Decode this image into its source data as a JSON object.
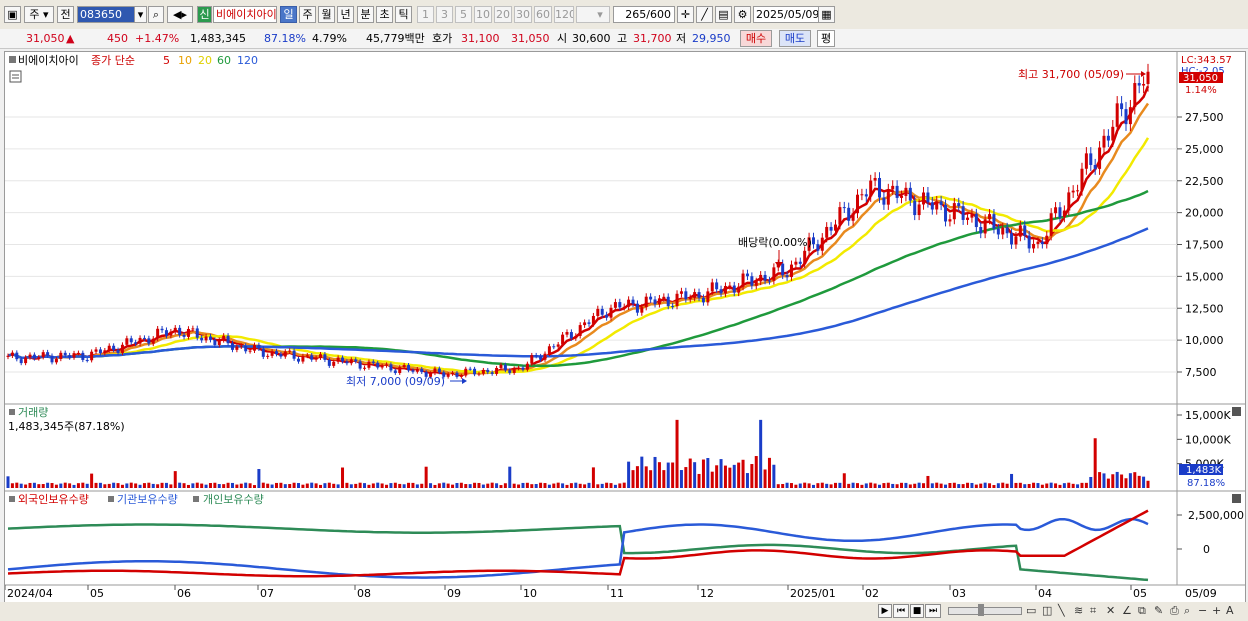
{
  "toolbar": {
    "market": "주",
    "all": "전",
    "code": "083650",
    "new_badge": "신",
    "name": "비에이치아이",
    "periods": [
      "일",
      "주",
      "월",
      "년",
      "분",
      "초",
      "틱"
    ],
    "active_period": "일",
    "minutes": [
      "1",
      "3",
      "5",
      "10",
      "20",
      "30",
      "60",
      "120"
    ],
    "count": "265",
    "count_max": "/600",
    "date": "2025/05/09"
  },
  "quote": {
    "price": "31,050",
    "arrow": "▲",
    "change": "450",
    "change_pct": "+1.47%",
    "volume": "1,483,345",
    "vol_ratio": "87.18%",
    "turnover": "4.79%",
    "amount": "45,779백만",
    "hoga_label": "호가",
    "ask": "31,100",
    "bid": "31,050",
    "open_label": "시",
    "open": "30,600",
    "high_label": "고",
    "high": "31,700",
    "low_label": "저",
    "low": "29,950",
    "buy_label": "매수",
    "sell_label": "매도",
    "eval_label": "평"
  },
  "price_panel": {
    "stock": "비에이치아이",
    "ma_label": "종가 단순",
    "ma_periods": [
      "5",
      "10",
      "20",
      "60",
      "120"
    ],
    "ma_colors": [
      "#d20000",
      "#e88a1e",
      "#f2ea00",
      "#1f9a3c",
      "#2a5ad8"
    ],
    "lc": "LC:343.57",
    "hc": "HC:-2.05",
    "price_tag": "31,050",
    "pct_tag": "1.14%",
    "high_note": "최고 31,700 (05/09)",
    "low_note": "최저 7,000 (09/09)",
    "dividend_note": "배당락(0.00%)",
    "y_ticks": [
      "27,500",
      "25,000",
      "22,500",
      "20,000",
      "17,500",
      "15,000",
      "12,500",
      "10,000",
      "7,500"
    ]
  },
  "volume_panel": {
    "title": "거래량",
    "value": "1,483,345주(87.18%)",
    "y_ticks": [
      "15,000K",
      "10,000K",
      "5,000K"
    ],
    "tag_value": "1,483K",
    "tag_pct": "87.18%"
  },
  "holdings_panel": {
    "legend": [
      "외국인보유수량",
      "기관보유수량",
      "개인보유수량"
    ],
    "legend_colors": [
      "#d20000",
      "#2a5ad8",
      "#2e8b57"
    ],
    "y_ticks": [
      "2,500,000",
      "0"
    ]
  },
  "x_axis": [
    "2024/04",
    "05",
    "06",
    "07",
    "08",
    "09",
    "10",
    "11",
    "12",
    "2025/01",
    "02",
    "03",
    "04",
    "05",
    "05/09"
  ],
  "chart_data": {
    "type": "candlestick",
    "stock": "비에이치아이",
    "xlabels": [
      "2024/04",
      "05",
      "06",
      "07",
      "08",
      "09",
      "10",
      "11",
      "12",
      "2025/01",
      "02",
      "03",
      "04",
      "05"
    ],
    "close_approx": [
      {
        "x": "2024/04",
        "y": 8600
      },
      {
        "x": "05",
        "y": 8800
      },
      {
        "x": "06",
        "y": 10800
      },
      {
        "x": "07",
        "y": 9100
      },
      {
        "x": "08",
        "y": 8200
      },
      {
        "x": "09",
        "y": 7300
      },
      {
        "x": "10",
        "y": 7800
      },
      {
        "x": "11",
        "y": 12500
      },
      {
        "x": "12",
        "y": 13500
      },
      {
        "x": "2025/01",
        "y": 15500
      },
      {
        "x": "02",
        "y": 22000
      },
      {
        "x": "03",
        "y": 20000
      },
      {
        "x": "04",
        "y": 17500
      },
      {
        "x": "05",
        "y": 31050
      }
    ],
    "high": {
      "value": 31700,
      "date": "05/09"
    },
    "low": {
      "value": 7000,
      "date": "09/09"
    },
    "y_range": [
      6000,
      33000
    ],
    "volume_ylim": [
      0,
      16000000
    ]
  }
}
